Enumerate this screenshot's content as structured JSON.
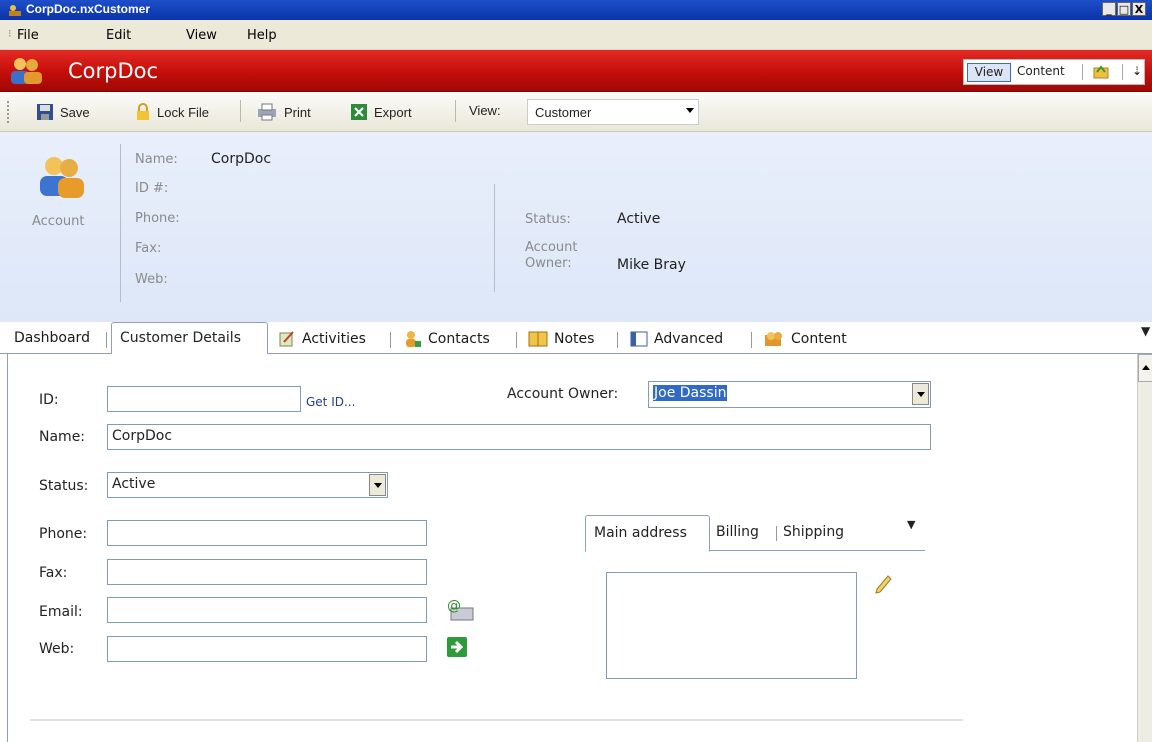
{
  "window": {
    "title": "CorpDoc.nxCustomer",
    "controls": [
      "_",
      "□",
      "X"
    ]
  },
  "menu": [
    "File",
    "Edit",
    "View",
    "Help"
  ],
  "brand": {
    "title": "CorpDoc",
    "view_label": "View",
    "content_label": "Content"
  },
  "toolbar": {
    "save": "Save",
    "lock": "Lock File",
    "print": "Print",
    "export": "Export",
    "view_label": "View:",
    "view_value": "Customer"
  },
  "header": {
    "icon_label": "Account",
    "name_label": "Name:",
    "name_value": "CorpDoc",
    "id_label": "ID #:",
    "phone_label": "Phone:",
    "fax_label": "Fax:",
    "web_label": "Web:",
    "status_label": "Status:",
    "status_value": "Active",
    "owner_label_1": "Account",
    "owner_label_2": "Owner:",
    "owner_value": "Mike Bray"
  },
  "tabs": {
    "dashboard": "Dashboard",
    "customer_details": "Customer Details",
    "activities": "Activities",
    "contacts": "Contacts",
    "notes": "Notes",
    "advanced": "Advanced",
    "content": "Content"
  },
  "form": {
    "id_label": "ID:",
    "id_value": "",
    "get_id": "Get ID...",
    "owner_label": "Account Owner:",
    "owner_value": "Joe Dassin",
    "name_label": "Name:",
    "name_value": "CorpDoc",
    "status_label": "Status:",
    "status_value": "Active",
    "phone_label": "Phone:",
    "phone_value": "",
    "fax_label": "Fax:",
    "fax_value": "",
    "email_label": "Email:",
    "email_value": "",
    "web_label": "Web:",
    "web_value": ""
  },
  "address": {
    "main": "Main address",
    "billing": "Billing",
    "shipping": "Shipping"
  }
}
